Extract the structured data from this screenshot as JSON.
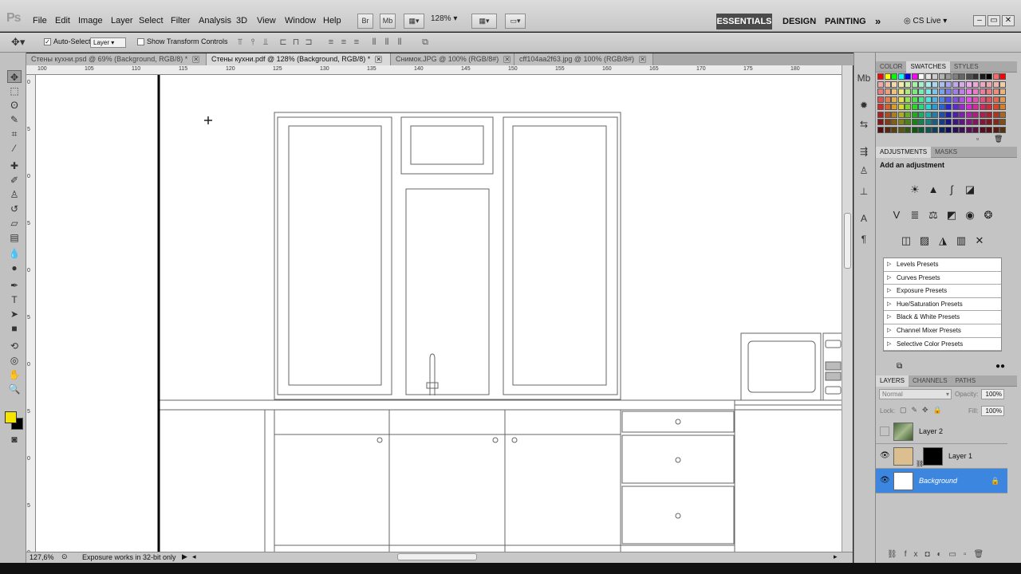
{
  "app": {
    "logo": "Ps"
  },
  "menu": [
    "File",
    "Edit",
    "Image",
    "Layer",
    "Select",
    "Filter",
    "Analysis",
    "3D",
    "View",
    "Window",
    "Help"
  ],
  "menubar_buttons": [
    "Br",
    "Mb"
  ],
  "zoom": "128%",
  "workspaces": {
    "essentials": "ESSENTIALS",
    "design": "DESIGN",
    "painting": "PAINTING",
    "more": "»",
    "cslive": "CS Live"
  },
  "options": {
    "auto_select": "Auto-Select:",
    "auto_select_value": "Layer",
    "show_transform": "Show Transform Controls"
  },
  "tabs": [
    {
      "label": "Стены кухни.psd @ 69% (Background, RGB/8) *"
    },
    {
      "label": "Стены кухни.pdf @ 128% (Background, RGB/8) *"
    },
    {
      "label": "Снимок.JPG @ 100% (RGB/8#)"
    },
    {
      "label": "cff104aa2f63.jpg @ 100% (RGB/8#)"
    }
  ],
  "ruler_top": [
    "100",
    "105",
    "110",
    "115",
    "120",
    "125",
    "130",
    "135",
    "140",
    "145",
    "150",
    "155",
    "160",
    "165",
    "170",
    "175",
    "180"
  ],
  "ruler_left": [
    "0",
    "5",
    "0",
    "5",
    "0",
    "5",
    "0",
    "5",
    "0",
    "5",
    "0"
  ],
  "status": {
    "zoom": "127,6%",
    "message": "Exposure works in 32-bit only"
  },
  "swatch_tabs": {
    "color": "COLOR",
    "swatches": "SWATCHES",
    "styles": "STYLES"
  },
  "adjustments": {
    "tabs": {
      "adjustments": "ADJUSTMENTS",
      "masks": "MASKS"
    },
    "title": "Add an adjustment",
    "presets": [
      "Levels Presets",
      "Curves Presets",
      "Exposure Presets",
      "Hue/Saturation Presets",
      "Black & White Presets",
      "Channel Mixer Presets",
      "Selective Color Presets"
    ]
  },
  "layers_panel": {
    "tabs": {
      "layers": "LAYERS",
      "channels": "CHANNELS",
      "paths": "PATHS"
    },
    "blend": "Normal",
    "opacity_label": "Opacity:",
    "opacity": "100%",
    "lock_label": "Lock:",
    "fill_label": "Fill:",
    "fill": "100%",
    "layers": [
      {
        "name": "Layer 2",
        "visible": false
      },
      {
        "name": "Layer 1",
        "visible": true
      },
      {
        "name": "Background",
        "visible": true,
        "selected": true
      }
    ]
  },
  "colors": {
    "foreground": "#f5e400",
    "background": "#000000",
    "selection": "#3d86e0"
  }
}
